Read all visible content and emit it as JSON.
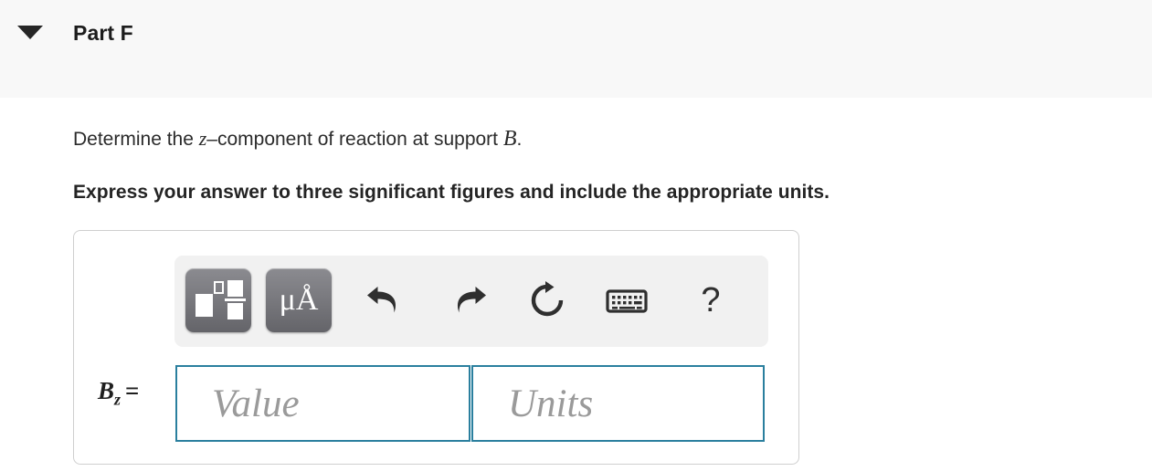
{
  "header": {
    "title": "Part F",
    "toggle_icon": "caret-down-icon",
    "expanded": true
  },
  "question": {
    "prefix": "Determine the ",
    "var_z": "z",
    "middle": "–component of reaction at support ",
    "var_b": "B",
    "suffix": ".",
    "instruction": "Express your answer to three significant figures and include the appropriate units."
  },
  "answer": {
    "label_var": "B",
    "label_sub": "z",
    "label_eq": "=",
    "value_placeholder": "Value",
    "units_placeholder": "Units",
    "value_text": "",
    "units_text": ""
  },
  "toolbar": {
    "buttons": [
      {
        "name": "math-template-button",
        "icon": "math-template-icon",
        "label": ""
      },
      {
        "name": "units-button",
        "icon": "micro-angstrom-icon",
        "label": "μÅ"
      }
    ],
    "icons": [
      {
        "name": "undo-button",
        "icon": "undo-arrow-icon"
      },
      {
        "name": "redo-button",
        "icon": "redo-arrow-icon"
      },
      {
        "name": "reset-button",
        "icon": "reset-circular-arrow-icon"
      },
      {
        "name": "keyboard-shortcuts-button",
        "icon": "keyboard-icon"
      },
      {
        "name": "help-button",
        "icon": "question-mark-icon",
        "label": "?"
      }
    ]
  },
  "colors": {
    "header_background": "#f8f8f8",
    "field_border": "#2a7f9e",
    "toolbar_background": "#f1f1f1",
    "button_gray": "#79797e",
    "placeholder_gray": "#9a9a9a",
    "box_border": "#cfcfcf",
    "text": "#2b2b2b"
  }
}
